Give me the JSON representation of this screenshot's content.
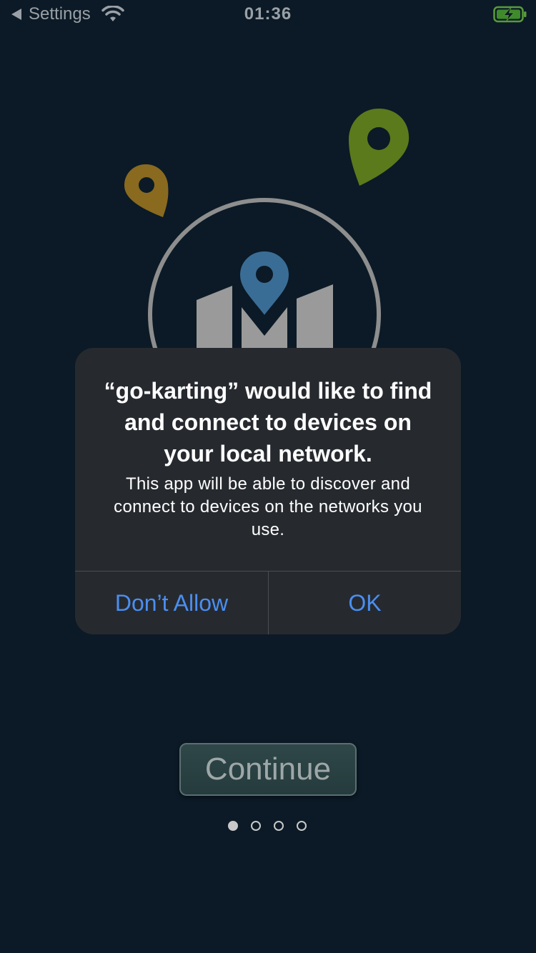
{
  "status_bar": {
    "back_label": "Settings",
    "time": "01:36",
    "icons": [
      "back-arrow-icon",
      "wifi-icon",
      "battery-charging-icon"
    ]
  },
  "illustration": {
    "icons": [
      "map-icon",
      "location-pin-icon"
    ],
    "colors": {
      "pin_gold": "#8a6a1f",
      "pin_green": "#5b7a1c",
      "pin_blue": "#3a6d95",
      "map_gray": "#9a9a9a",
      "circle_gray": "#8e8e8e"
    }
  },
  "alert": {
    "title": "“go-karting” would like to find and connect to devices on your local network.",
    "message": "This app will be able to discover and connect to devices on the networks you use.",
    "deny_label": "Don’t Allow",
    "ok_label": "OK",
    "accent_color": "#4b8ef0"
  },
  "continue_button": {
    "label": "Continue"
  },
  "pagination": {
    "total_pages": 4,
    "current_page": 1
  }
}
